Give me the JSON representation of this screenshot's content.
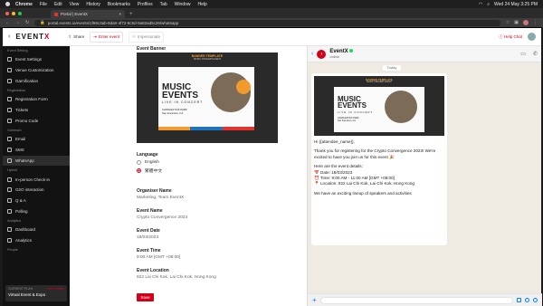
{
  "menubar": {
    "app": "Chrome",
    "items": [
      "File",
      "Edit",
      "View",
      "History",
      "Bookmarks",
      "Profiles",
      "Tab",
      "Window",
      "Help"
    ],
    "datetime": "Wed 24 May  3:25 PM"
  },
  "browser": {
    "tab_title": "Portal | EventX",
    "url": "portal.events.io/events/1f69c3ab-8da0-4f72-8c5d-9a82ad5c26/whatsapp"
  },
  "app_header": {
    "logo": "EVENTX",
    "share_label": "Share",
    "enter_event_label": "Enter event",
    "impersonate_label": "Impersonate",
    "help_label": "Help Chat"
  },
  "sidebar": {
    "sections": [
      {
        "title": "Event Setting",
        "items": [
          {
            "label": "Event Settings"
          },
          {
            "label": "Venue Customization"
          },
          {
            "label": "Gamification"
          }
        ]
      },
      {
        "title": "Registration",
        "items": [
          {
            "label": "Registration Form"
          },
          {
            "label": "Tickets"
          },
          {
            "label": "Promo Code"
          }
        ]
      },
      {
        "title": "Outreach",
        "items": [
          {
            "label": "Email"
          },
          {
            "label": "SMS"
          },
          {
            "label": "WhatsApp"
          }
        ]
      },
      {
        "title": "Hybrid",
        "items": [
          {
            "label": "In-person Check-in"
          },
          {
            "label": "O2O interaction"
          },
          {
            "label": "Q & A"
          },
          {
            "label": "Polling"
          }
        ]
      },
      {
        "title": "Analytics",
        "items": [
          {
            "label": "Dashboard"
          },
          {
            "label": "Analytics"
          }
        ]
      },
      {
        "title": "People",
        "items": []
      }
    ],
    "active": "WhatsApp",
    "plan": {
      "label": "CURRENT PLAN",
      "link": "View Details",
      "name": "Virtual Event & Expo"
    }
  },
  "form": {
    "banner_label": "Event Banner",
    "banner": {
      "header": "BANNER TEMPLATE",
      "subheader": "MUSIC CONCERT EVENT",
      "title_line1": "MUSIC",
      "title_line2": "EVENTS",
      "tagline": "LIVE IN CONCERT",
      "venue": "CANDLESTICK PARK",
      "city": "San Francisco, CA"
    },
    "language_label": "Language",
    "languages": [
      "English",
      "繁體中文"
    ],
    "selected_language": "繁體中文",
    "organiser_label": "Organiser Name",
    "organiser_value": "Marketing, Team EventX",
    "event_name_label": "Event Name",
    "event_name_value": "Crypto Convergence 2023",
    "event_date_label": "Event Date",
    "event_date_value": "18/03/2023",
    "event_time_label": "Event Time",
    "event_time_value": "9:00 AM [GMT +08:00]",
    "event_location_label": "Event Location",
    "event_location_value": "822 Lai Chi Kok, Lai Chi Kok, Hong Kong",
    "save_label": "Save"
  },
  "whatsapp": {
    "contact_name": "EventX",
    "status": "online",
    "date_chip": "Today",
    "message": {
      "greeting": "Hi {{attendee_name}},",
      "line1": "Thank you for registering for the Crypto Convergence 2023! We're excited to have you join us for this event 🎉",
      "details_intro": "Here are the event details:",
      "date": "📅 Date: 18/03/2023",
      "time": "⏰ Time: 9:00 AM - 11:00 AM [GMT +08:00]",
      "location": "📍 Location: 822 Lai Chi Kok, Lai Chi Kok, Hong Kong",
      "more": "We have an exciting lineup of speakers and activities"
    }
  }
}
